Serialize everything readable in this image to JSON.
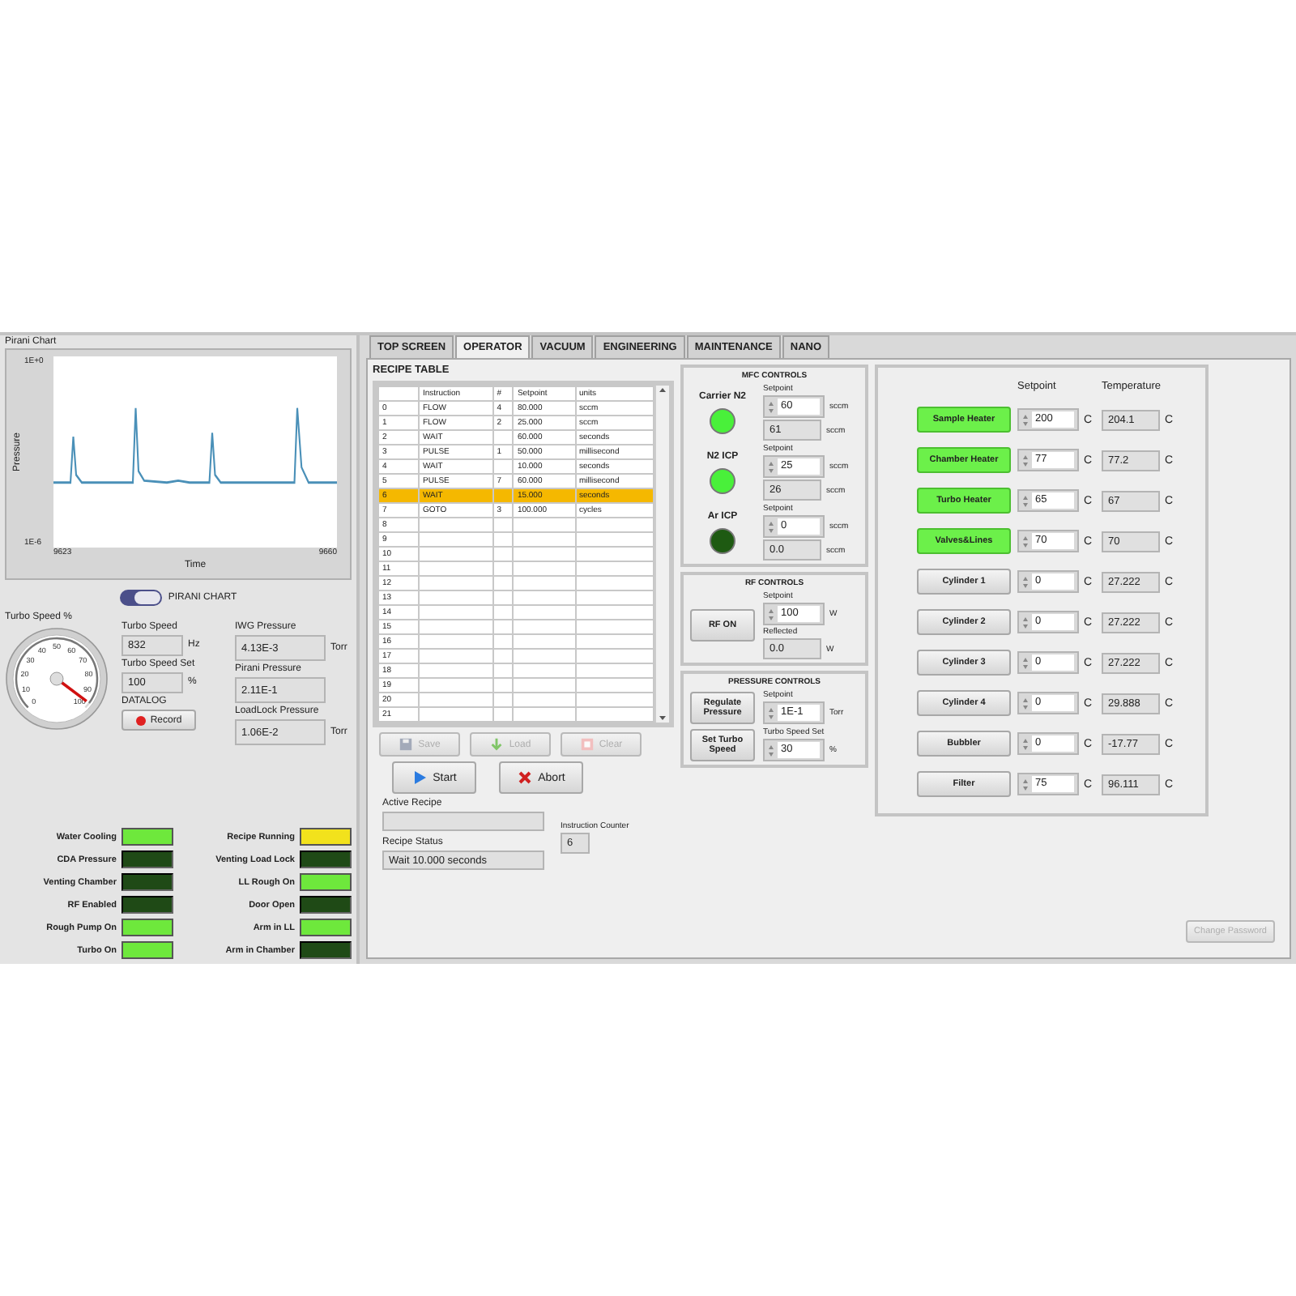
{
  "chart_panel": {
    "title": "Pirani Chart",
    "ylabel": "Pressure",
    "xlabel": "Time",
    "y_top": "1E+0",
    "y_bottom": "1E-6",
    "x_start": "9623",
    "x_end": "9660"
  },
  "chart_toggle": {
    "label": "PIRANI CHART",
    "on": true
  },
  "turbo_gauge": {
    "label": "Turbo Speed %",
    "scale": [
      "0",
      "10",
      "20",
      "30",
      "40",
      "50",
      "60",
      "70",
      "80",
      "90",
      "100"
    ],
    "level": 0.97
  },
  "readouts_left": [
    {
      "label": "Turbo Speed",
      "value": "832",
      "unit": "Hz"
    },
    {
      "label": "Turbo Speed Set",
      "value": "100",
      "unit": "%"
    }
  ],
  "datalog": {
    "label": "DATALOG",
    "button": "Record"
  },
  "readouts_right": [
    {
      "label": "IWG Pressure",
      "value": "4.13E-3",
      "unit": "Torr"
    },
    {
      "label": "Pirani Pressure",
      "value": "2.11E-1"
    },
    {
      "label": "LoadLock Pressure",
      "value": "1.06E-2",
      "unit": "Torr"
    }
  ],
  "lamps_left": [
    {
      "label": "Water Cooling",
      "on": true,
      "color": "#6ee83c"
    },
    {
      "label": "CDA Pressure",
      "on": false,
      "color": "#1f4a16"
    },
    {
      "label": "Venting Chamber",
      "on": false,
      "color": "#1f4a16"
    },
    {
      "label": "RF Enabled",
      "on": false,
      "color": "#1f4a16"
    },
    {
      "label": "Rough Pump On",
      "on": true,
      "color": "#6ee83c"
    },
    {
      "label": "Turbo On",
      "on": true,
      "color": "#6ee83c"
    }
  ],
  "lamps_right": [
    {
      "label": "Recipe Running",
      "on": true,
      "color": "#f2e21c"
    },
    {
      "label": "Venting Load Lock",
      "on": false,
      "color": "#1f4a16"
    },
    {
      "label": "LL Rough On",
      "on": true,
      "color": "#6ee83c"
    },
    {
      "label": "Door Open",
      "on": false,
      "color": "#1f4a16"
    },
    {
      "label": "Arm in LL",
      "on": true,
      "color": "#6ee83c"
    },
    {
      "label": "Arm in Chamber",
      "on": false,
      "color": "#1f4a16"
    }
  ],
  "tabs": [
    {
      "label": "TOP SCREEN",
      "selected": false
    },
    {
      "label": "OPERATOR",
      "selected": true
    },
    {
      "label": "VACUUM",
      "selected": false
    },
    {
      "label": "ENGINEERING",
      "selected": false
    },
    {
      "label": "MAINTENANCE",
      "selected": false
    },
    {
      "label": "NANO",
      "selected": false
    }
  ],
  "recipe": {
    "title": "RECIPE TABLE",
    "columns": [
      "Instruction",
      "#",
      "Setpoint",
      "units"
    ],
    "rows": [
      {
        "index": "0",
        "cells": [
          "FLOW",
          "4",
          "80.000",
          "sccm"
        ],
        "selected": false
      },
      {
        "index": "1",
        "cells": [
          "FLOW",
          "2",
          "25.000",
          "sccm"
        ],
        "selected": false
      },
      {
        "index": "2",
        "cells": [
          "WAIT",
          "",
          "60.000",
          "seconds"
        ],
        "selected": false
      },
      {
        "index": "3",
        "cells": [
          "PULSE",
          "1",
          "50.000",
          "millisecond"
        ],
        "selected": false
      },
      {
        "index": "4",
        "cells": [
          "WAIT",
          "",
          "10.000",
          "seconds"
        ],
        "selected": false
      },
      {
        "index": "5",
        "cells": [
          "PULSE",
          "7",
          "60.000",
          "millisecond"
        ],
        "selected": false
      },
      {
        "index": "6",
        "cells": [
          "WAIT",
          "",
          "15.000",
          "seconds"
        ],
        "selected": true
      },
      {
        "index": "7",
        "cells": [
          "GOTO",
          "3",
          "100.000",
          "cycles"
        ],
        "selected": false
      },
      {
        "index": "8",
        "selected": false
      },
      {
        "index": "9",
        "selected": false
      },
      {
        "index": "10",
        "selected": false
      },
      {
        "index": "11",
        "selected": false
      },
      {
        "index": "12",
        "selected": false
      },
      {
        "index": "13",
        "selected": false
      },
      {
        "index": "14",
        "selected": false
      },
      {
        "index": "15",
        "selected": false
      },
      {
        "index": "16",
        "selected": false
      },
      {
        "index": "17",
        "selected": false
      },
      {
        "index": "18",
        "selected": false
      },
      {
        "index": "19",
        "selected": false
      },
      {
        "index": "20",
        "selected": false
      },
      {
        "index": "21",
        "selected": false
      }
    ]
  },
  "file_buttons": [
    {
      "label": "Save",
      "kind": "save",
      "disabled": true
    },
    {
      "label": "Load",
      "kind": "load",
      "disabled": true
    },
    {
      "label": "Clear",
      "kind": "clear",
      "disabled": true
    }
  ],
  "run_buttons": [
    {
      "label": "Start",
      "kind": "start",
      "disabled": false
    },
    {
      "label": "Abort",
      "kind": "abort",
      "disabled": false
    }
  ],
  "active_recipe": {
    "label": "Active Recipe"
  },
  "recipe_status": {
    "label": "Recipe Status",
    "value": "Wait 10.000 seconds"
  },
  "instruction_counter": {
    "label": "Instruction Counter",
    "value": "6"
  },
  "mfc": {
    "title": "MFC CONTROLS",
    "channels": [
      {
        "name": "Carrier N2",
        "on": true,
        "setpoint_label": "Setpoint",
        "setpoint": "60",
        "setpoint_unit": "sccm",
        "reading": "61",
        "reading_unit": "sccm"
      },
      {
        "name": "N2 ICP",
        "on": true,
        "setpoint_label": "Setpoint",
        "setpoint": "25",
        "setpoint_unit": "sccm",
        "reading": "26",
        "reading_unit": "sccm"
      },
      {
        "name": "Ar ICP",
        "on": false,
        "setpoint_label": "Setpoint",
        "setpoint": "0",
        "setpoint_unit": "sccm",
        "reading": "0.0",
        "reading_unit": "sccm"
      }
    ]
  },
  "rf": {
    "title": "RF CONTROLS",
    "button": "RF ON",
    "setpoint_label": "Setpoint",
    "setpoint": "100",
    "setpoint_unit": "W",
    "reflected_label": "Reflected",
    "reflected": "0.0",
    "reflected_unit": "W"
  },
  "pressure": {
    "title": "PRESSURE CONTROLS",
    "rows": [
      {
        "button": "Regulate Pressure",
        "label": "Setpoint",
        "value": "1E-1",
        "unit": "Torr"
      },
      {
        "button": "Set Turbo Speed",
        "label": "Turbo Speed Set",
        "value": "30",
        "unit": "%"
      }
    ]
  },
  "heaters": {
    "setpoint_header": "Setpoint",
    "temperature_header": "Temperature",
    "rows": [
      {
        "name": "Sample Heater",
        "on": true,
        "setpoint": "200",
        "setpoint_unit": "C",
        "temperature": "204.1",
        "temperature_unit": "C"
      },
      {
        "name": "Chamber Heater",
        "on": true,
        "setpoint": "77",
        "setpoint_unit": "C",
        "temperature": "77.2",
        "temperature_unit": "C"
      },
      {
        "name": "Turbo Heater",
        "on": true,
        "setpoint": "65",
        "setpoint_unit": "C",
        "temperature": "67",
        "temperature_unit": "C"
      },
      {
        "name": "Valves&Lines",
        "on": true,
        "setpoint": "70",
        "setpoint_unit": "C",
        "temperature": "70",
        "temperature_unit": "C"
      },
      {
        "name": "Cylinder 1",
        "on": false,
        "setpoint": "0",
        "setpoint_unit": "C",
        "temperature": "27.222",
        "temperature_unit": "C"
      },
      {
        "name": "Cylinder 2",
        "on": false,
        "setpoint": "0",
        "setpoint_unit": "C",
        "temperature": "27.222",
        "temperature_unit": "C"
      },
      {
        "name": "Cylinder 3",
        "on": false,
        "setpoint": "0",
        "setpoint_unit": "C",
        "temperature": "27.222",
        "temperature_unit": "C"
      },
      {
        "name": "Cylinder 4",
        "on": false,
        "setpoint": "0",
        "setpoint_unit": "C",
        "temperature": "29.888",
        "temperature_unit": "C"
      },
      {
        "name": "Bubbler",
        "on": false,
        "setpoint": "0",
        "setpoint_unit": "C",
        "temperature": "-17.77",
        "temperature_unit": "C"
      },
      {
        "name": "Filter",
        "on": false,
        "setpoint": "75",
        "setpoint_unit": "C",
        "temperature": "96.111",
        "temperature_unit": "C"
      }
    ]
  },
  "change_password": {
    "label": "Change Password",
    "disabled": true
  }
}
